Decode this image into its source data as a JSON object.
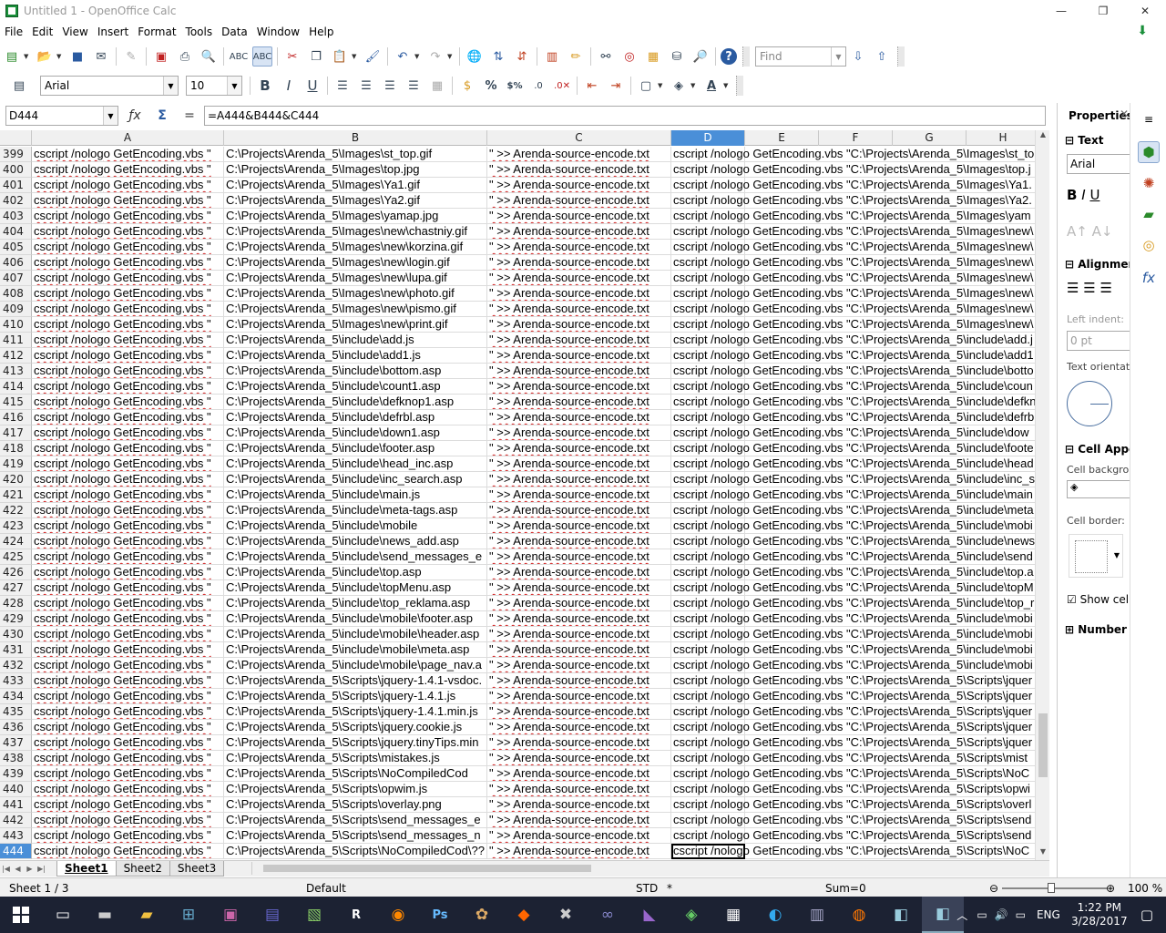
{
  "window": {
    "title": "Untitled 1 - OpenOffice Calc",
    "minimize": "—",
    "maximize": "❐",
    "close": "✕"
  },
  "menu": [
    "File",
    "Edit",
    "View",
    "Insert",
    "Format",
    "Tools",
    "Data",
    "Window",
    "Help"
  ],
  "toolbar": {
    "find_placeholder": "Find"
  },
  "format_toolbar": {
    "font_name": "Arial",
    "font_size": "10"
  },
  "formula_bar": {
    "name_box": "D444",
    "formula": "=A444&B444&C444"
  },
  "columns": [
    "A",
    "B",
    "C",
    "D",
    "E",
    "F",
    "G",
    "H"
  ],
  "selected_column": "D",
  "active_row": 444,
  "rows": [
    {
      "n": "399",
      "a": "cscript /nologo GetEncoding.vbs \"",
      "b": "C:\\Projects\\Arenda_5\\Images\\st_top.gif",
      "c": "\" >> Arenda-source-encode.txt",
      "d": "cscript /nologo GetEncoding.vbs \"C:\\Projects\\Arenda_5\\Images\\st_to"
    },
    {
      "n": "400",
      "a": "cscript /nologo GetEncoding.vbs \"",
      "b": "C:\\Projects\\Arenda_5\\Images\\top.jpg",
      "c": "\" >> Arenda-source-encode.txt",
      "d": "cscript /nologo GetEncoding.vbs \"C:\\Projects\\Arenda_5\\Images\\top.j"
    },
    {
      "n": "401",
      "a": "cscript /nologo GetEncoding.vbs \"",
      "b": "C:\\Projects\\Arenda_5\\Images\\Ya1.gif",
      "c": "\" >> Arenda-source-encode.txt",
      "d": "cscript /nologo GetEncoding.vbs \"C:\\Projects\\Arenda_5\\Images\\Ya1."
    },
    {
      "n": "402",
      "a": "cscript /nologo GetEncoding.vbs \"",
      "b": "C:\\Projects\\Arenda_5\\Images\\Ya2.gif",
      "c": "\" >> Arenda-source-encode.txt",
      "d": "cscript /nologo GetEncoding.vbs \"C:\\Projects\\Arenda_5\\Images\\Ya2."
    },
    {
      "n": "403",
      "a": "cscript /nologo GetEncoding.vbs \"",
      "b": "C:\\Projects\\Arenda_5\\Images\\yamap.jpg",
      "c": "\" >> Arenda-source-encode.txt",
      "d": "cscript /nologo GetEncoding.vbs \"C:\\Projects\\Arenda_5\\Images\\yam"
    },
    {
      "n": "404",
      "a": "cscript /nologo GetEncoding.vbs \"",
      "b": "C:\\Projects\\Arenda_5\\Images\\new\\chastniy.gif",
      "c": "\" >> Arenda-source-encode.txt",
      "d": "cscript /nologo GetEncoding.vbs \"C:\\Projects\\Arenda_5\\Images\\new\\"
    },
    {
      "n": "405",
      "a": "cscript /nologo GetEncoding.vbs \"",
      "b": "C:\\Projects\\Arenda_5\\Images\\new\\korzina.gif",
      "c": "\" >> Arenda-source-encode.txt",
      "d": "cscript /nologo GetEncoding.vbs \"C:\\Projects\\Arenda_5\\Images\\new\\"
    },
    {
      "n": "406",
      "a": "cscript /nologo GetEncoding.vbs \"",
      "b": "C:\\Projects\\Arenda_5\\Images\\new\\login.gif",
      "c": "\" >> Arenda-source-encode.txt",
      "d": "cscript /nologo GetEncoding.vbs \"C:\\Projects\\Arenda_5\\Images\\new\\"
    },
    {
      "n": "407",
      "a": "cscript /nologo GetEncoding.vbs \"",
      "b": "C:\\Projects\\Arenda_5\\Images\\new\\lupa.gif",
      "c": "\" >> Arenda-source-encode.txt",
      "d": "cscript /nologo GetEncoding.vbs \"C:\\Projects\\Arenda_5\\Images\\new\\"
    },
    {
      "n": "408",
      "a": "cscript /nologo GetEncoding.vbs \"",
      "b": "C:\\Projects\\Arenda_5\\Images\\new\\photo.gif",
      "c": "\" >> Arenda-source-encode.txt",
      "d": "cscript /nologo GetEncoding.vbs \"C:\\Projects\\Arenda_5\\Images\\new\\"
    },
    {
      "n": "409",
      "a": "cscript /nologo GetEncoding.vbs \"",
      "b": "C:\\Projects\\Arenda_5\\Images\\new\\pismo.gif",
      "c": "\" >> Arenda-source-encode.txt",
      "d": "cscript /nologo GetEncoding.vbs \"C:\\Projects\\Arenda_5\\Images\\new\\"
    },
    {
      "n": "410",
      "a": "cscript /nologo GetEncoding.vbs \"",
      "b": "C:\\Projects\\Arenda_5\\Images\\new\\print.gif",
      "c": "\" >> Arenda-source-encode.txt",
      "d": "cscript /nologo GetEncoding.vbs \"C:\\Projects\\Arenda_5\\Images\\new\\"
    },
    {
      "n": "411",
      "a": "cscript /nologo GetEncoding.vbs \"",
      "b": "C:\\Projects\\Arenda_5\\include\\add.js",
      "c": "\" >> Arenda-source-encode.txt",
      "d": "cscript /nologo GetEncoding.vbs \"C:\\Projects\\Arenda_5\\include\\add.j"
    },
    {
      "n": "412",
      "a": "cscript /nologo GetEncoding.vbs \"",
      "b": "C:\\Projects\\Arenda_5\\include\\add1.js",
      "c": "\" >> Arenda-source-encode.txt",
      "d": "cscript /nologo GetEncoding.vbs \"C:\\Projects\\Arenda_5\\include\\add1"
    },
    {
      "n": "413",
      "a": "cscript /nologo GetEncoding.vbs \"",
      "b": "C:\\Projects\\Arenda_5\\include\\bottom.asp",
      "c": "\" >> Arenda-source-encode.txt",
      "d": "cscript /nologo GetEncoding.vbs \"C:\\Projects\\Arenda_5\\include\\botto"
    },
    {
      "n": "414",
      "a": "cscript /nologo GetEncoding.vbs \"",
      "b": "C:\\Projects\\Arenda_5\\include\\count1.asp",
      "c": "\" >> Arenda-source-encode.txt",
      "d": "cscript /nologo GetEncoding.vbs \"C:\\Projects\\Arenda_5\\include\\coun"
    },
    {
      "n": "415",
      "a": "cscript /nologo GetEncoding.vbs \"",
      "b": "C:\\Projects\\Arenda_5\\include\\defknop1.asp",
      "c": "\" >> Arenda-source-encode.txt",
      "d": "cscript /nologo GetEncoding.vbs \"C:\\Projects\\Arenda_5\\include\\defkn"
    },
    {
      "n": "416",
      "a": "cscript /nologo GetEncoding.vbs \"",
      "b": "C:\\Projects\\Arenda_5\\include\\defrbl.asp",
      "c": "\" >> Arenda-source-encode.txt",
      "d": "cscript /nologo GetEncoding.vbs \"C:\\Projects\\Arenda_5\\include\\defrb"
    },
    {
      "n": "417",
      "a": "cscript /nologo GetEncoding.vbs \"",
      "b": "C:\\Projects\\Arenda_5\\include\\down1.asp",
      "c": "\" >> Arenda-source-encode.txt",
      "d": "cscript /nologo GetEncoding.vbs \"C:\\Projects\\Arenda_5\\include\\dow"
    },
    {
      "n": "418",
      "a": "cscript /nologo GetEncoding.vbs \"",
      "b": "C:\\Projects\\Arenda_5\\include\\footer.asp",
      "c": "\" >> Arenda-source-encode.txt",
      "d": "cscript /nologo GetEncoding.vbs \"C:\\Projects\\Arenda_5\\include\\foote"
    },
    {
      "n": "419",
      "a": "cscript /nologo GetEncoding.vbs \"",
      "b": "C:\\Projects\\Arenda_5\\include\\head_inc.asp",
      "c": "\" >> Arenda-source-encode.txt",
      "d": "cscript /nologo GetEncoding.vbs \"C:\\Projects\\Arenda_5\\include\\head"
    },
    {
      "n": "420",
      "a": "cscript /nologo GetEncoding.vbs \"",
      "b": "C:\\Projects\\Arenda_5\\include\\inc_search.asp",
      "c": "\" >> Arenda-source-encode.txt",
      "d": "cscript /nologo GetEncoding.vbs \"C:\\Projects\\Arenda_5\\include\\inc_s"
    },
    {
      "n": "421",
      "a": "cscript /nologo GetEncoding.vbs \"",
      "b": "C:\\Projects\\Arenda_5\\include\\main.js",
      "c": "\" >> Arenda-source-encode.txt",
      "d": "cscript /nologo GetEncoding.vbs \"C:\\Projects\\Arenda_5\\include\\main"
    },
    {
      "n": "422",
      "a": "cscript /nologo GetEncoding.vbs \"",
      "b": "C:\\Projects\\Arenda_5\\include\\meta-tags.asp",
      "c": "\" >> Arenda-source-encode.txt",
      "d": "cscript /nologo GetEncoding.vbs \"C:\\Projects\\Arenda_5\\include\\meta"
    },
    {
      "n": "423",
      "a": "cscript /nologo GetEncoding.vbs \"",
      "b": "C:\\Projects\\Arenda_5\\include\\mobile",
      "c": "\" >> Arenda-source-encode.txt",
      "d": "cscript /nologo GetEncoding.vbs \"C:\\Projects\\Arenda_5\\include\\mobi"
    },
    {
      "n": "424",
      "a": "cscript /nologo GetEncoding.vbs \"",
      "b": "C:\\Projects\\Arenda_5\\include\\news_add.asp",
      "c": "\" >> Arenda-source-encode.txt",
      "d": "cscript /nologo GetEncoding.vbs \"C:\\Projects\\Arenda_5\\include\\news"
    },
    {
      "n": "425",
      "a": "cscript /nologo GetEncoding.vbs \"",
      "b": "C:\\Projects\\Arenda_5\\include\\send_messages_e",
      "c": "\" >> Arenda-source-encode.txt",
      "d": "cscript /nologo GetEncoding.vbs \"C:\\Projects\\Arenda_5\\include\\send"
    },
    {
      "n": "426",
      "a": "cscript /nologo GetEncoding.vbs \"",
      "b": "C:\\Projects\\Arenda_5\\include\\top.asp",
      "c": "\" >> Arenda-source-encode.txt",
      "d": "cscript /nologo GetEncoding.vbs \"C:\\Projects\\Arenda_5\\include\\top.a"
    },
    {
      "n": "427",
      "a": "cscript /nologo GetEncoding.vbs \"",
      "b": "C:\\Projects\\Arenda_5\\include\\topMenu.asp",
      "c": "\" >> Arenda-source-encode.txt",
      "d": "cscript /nologo GetEncoding.vbs \"C:\\Projects\\Arenda_5\\include\\topM"
    },
    {
      "n": "428",
      "a": "cscript /nologo GetEncoding.vbs \"",
      "b": "C:\\Projects\\Arenda_5\\include\\top_reklama.asp",
      "c": "\" >> Arenda-source-encode.txt",
      "d": "cscript /nologo GetEncoding.vbs \"C:\\Projects\\Arenda_5\\include\\top_r"
    },
    {
      "n": "429",
      "a": "cscript /nologo GetEncoding.vbs \"",
      "b": "C:\\Projects\\Arenda_5\\include\\mobile\\footer.asp",
      "c": "\" >> Arenda-source-encode.txt",
      "d": "cscript /nologo GetEncoding.vbs \"C:\\Projects\\Arenda_5\\include\\mobi"
    },
    {
      "n": "430",
      "a": "cscript /nologo GetEncoding.vbs \"",
      "b": "C:\\Projects\\Arenda_5\\include\\mobile\\header.asp",
      "c": "\" >> Arenda-source-encode.txt",
      "d": "cscript /nologo GetEncoding.vbs \"C:\\Projects\\Arenda_5\\include\\mobi"
    },
    {
      "n": "431",
      "a": "cscript /nologo GetEncoding.vbs \"",
      "b": "C:\\Projects\\Arenda_5\\include\\mobile\\meta.asp",
      "c": "\" >> Arenda-source-encode.txt",
      "d": "cscript /nologo GetEncoding.vbs \"C:\\Projects\\Arenda_5\\include\\mobi"
    },
    {
      "n": "432",
      "a": "cscript /nologo GetEncoding.vbs \"",
      "b": "C:\\Projects\\Arenda_5\\include\\mobile\\page_nav.a",
      "c": "\" >> Arenda-source-encode.txt",
      "d": "cscript /nologo GetEncoding.vbs \"C:\\Projects\\Arenda_5\\include\\mobi"
    },
    {
      "n": "433",
      "a": "cscript /nologo GetEncoding.vbs \"",
      "b": "C:\\Projects\\Arenda_5\\Scripts\\jquery-1.4.1-vsdoc.",
      "c": "\" >> Arenda-source-encode.txt",
      "d": "cscript /nologo GetEncoding.vbs \"C:\\Projects\\Arenda_5\\Scripts\\jquer"
    },
    {
      "n": "434",
      "a": "cscript /nologo GetEncoding.vbs \"",
      "b": "C:\\Projects\\Arenda_5\\Scripts\\jquery-1.4.1.js",
      "c": "\" >> Arenda-source-encode.txt",
      "d": "cscript /nologo GetEncoding.vbs \"C:\\Projects\\Arenda_5\\Scripts\\jquer"
    },
    {
      "n": "435",
      "a": "cscript /nologo GetEncoding.vbs \"",
      "b": "C:\\Projects\\Arenda_5\\Scripts\\jquery-1.4.1.min.js",
      "c": "\" >> Arenda-source-encode.txt",
      "d": "cscript /nologo GetEncoding.vbs \"C:\\Projects\\Arenda_5\\Scripts\\jquer"
    },
    {
      "n": "436",
      "a": "cscript /nologo GetEncoding.vbs \"",
      "b": "C:\\Projects\\Arenda_5\\Scripts\\jquery.cookie.js",
      "c": "\" >> Arenda-source-encode.txt",
      "d": "cscript /nologo GetEncoding.vbs \"C:\\Projects\\Arenda_5\\Scripts\\jquer"
    },
    {
      "n": "437",
      "a": "cscript /nologo GetEncoding.vbs \"",
      "b": "C:\\Projects\\Arenda_5\\Scripts\\jquery.tinyTips.min",
      "c": "\" >> Arenda-source-encode.txt",
      "d": "cscript /nologo GetEncoding.vbs \"C:\\Projects\\Arenda_5\\Scripts\\jquer"
    },
    {
      "n": "438",
      "a": "cscript /nologo GetEncoding.vbs \"",
      "b": "C:\\Projects\\Arenda_5\\Scripts\\mistakes.js",
      "c": "\" >> Arenda-source-encode.txt",
      "d": "cscript /nologo GetEncoding.vbs \"C:\\Projects\\Arenda_5\\Scripts\\mist"
    },
    {
      "n": "439",
      "a": "cscript /nologo GetEncoding.vbs \"",
      "b": "C:\\Projects\\Arenda_5\\Scripts\\NoCompiledCod",
      "c": "\" >> Arenda-source-encode.txt",
      "d": "cscript /nologo GetEncoding.vbs \"C:\\Projects\\Arenda_5\\Scripts\\NoC"
    },
    {
      "n": "440",
      "a": "cscript /nologo GetEncoding.vbs \"",
      "b": "C:\\Projects\\Arenda_5\\Scripts\\opwim.js",
      "c": "\" >> Arenda-source-encode.txt",
      "d": "cscript /nologo GetEncoding.vbs \"C:\\Projects\\Arenda_5\\Scripts\\opwi"
    },
    {
      "n": "441",
      "a": "cscript /nologo GetEncoding.vbs \"",
      "b": "C:\\Projects\\Arenda_5\\Scripts\\overlay.png",
      "c": "\" >> Arenda-source-encode.txt",
      "d": "cscript /nologo GetEncoding.vbs \"C:\\Projects\\Arenda_5\\Scripts\\overl"
    },
    {
      "n": "442",
      "a": "cscript /nologo GetEncoding.vbs \"",
      "b": "C:\\Projects\\Arenda_5\\Scripts\\send_messages_e",
      "c": "\" >> Arenda-source-encode.txt",
      "d": "cscript /nologo GetEncoding.vbs \"C:\\Projects\\Arenda_5\\Scripts\\send"
    },
    {
      "n": "443",
      "a": "cscript /nologo GetEncoding.vbs \"",
      "b": "C:\\Projects\\Arenda_5\\Scripts\\send_messages_n",
      "c": "\" >> Arenda-source-encode.txt",
      "d": "cscript /nologo GetEncoding.vbs \"C:\\Projects\\Arenda_5\\Scripts\\send"
    },
    {
      "n": "444",
      "a": "cscript /nologo GetEncoding.vbs \"",
      "b": "C:\\Projects\\Arenda_5\\Scripts\\NoCompiledCod\\??",
      "c": "\" >> Arenda-source-encode.txt",
      "d": "cscript /nologo GetEncoding.vbs \"C:\\Projects\\Arenda_5\\Scripts\\NoC"
    }
  ],
  "sheet_tabs": [
    "Sheet1",
    "Sheet2",
    "Sheet3"
  ],
  "active_sheet": "Sheet1",
  "sidebar": {
    "title": "Properties",
    "text_section": "Text",
    "font": "Arial",
    "alignment_section": "Alignment",
    "left_indent_label": "Left indent:",
    "left_indent_value": "0 pt",
    "text_orientation_label": "Text orientat",
    "cell_appearance_section": "Cell Appea",
    "cell_background_label": "Cell backgro",
    "cell_border_label": "Cell border:",
    "show_cell_label": "Show cel",
    "number_format_section": "Number Fo"
  },
  "status": {
    "sheet": "Sheet 1 / 3",
    "style": "Default",
    "mode": "STD",
    "modified": "*",
    "sum": "Sum=0",
    "zoom": "100 %"
  },
  "taskbar": {
    "language": "ENG",
    "time": "1:22 PM",
    "date": "3/28/2017"
  },
  "colors": {
    "selection": "#4a8fd8",
    "spell_underline": "#d02020",
    "taskbar": "#1c2233"
  }
}
